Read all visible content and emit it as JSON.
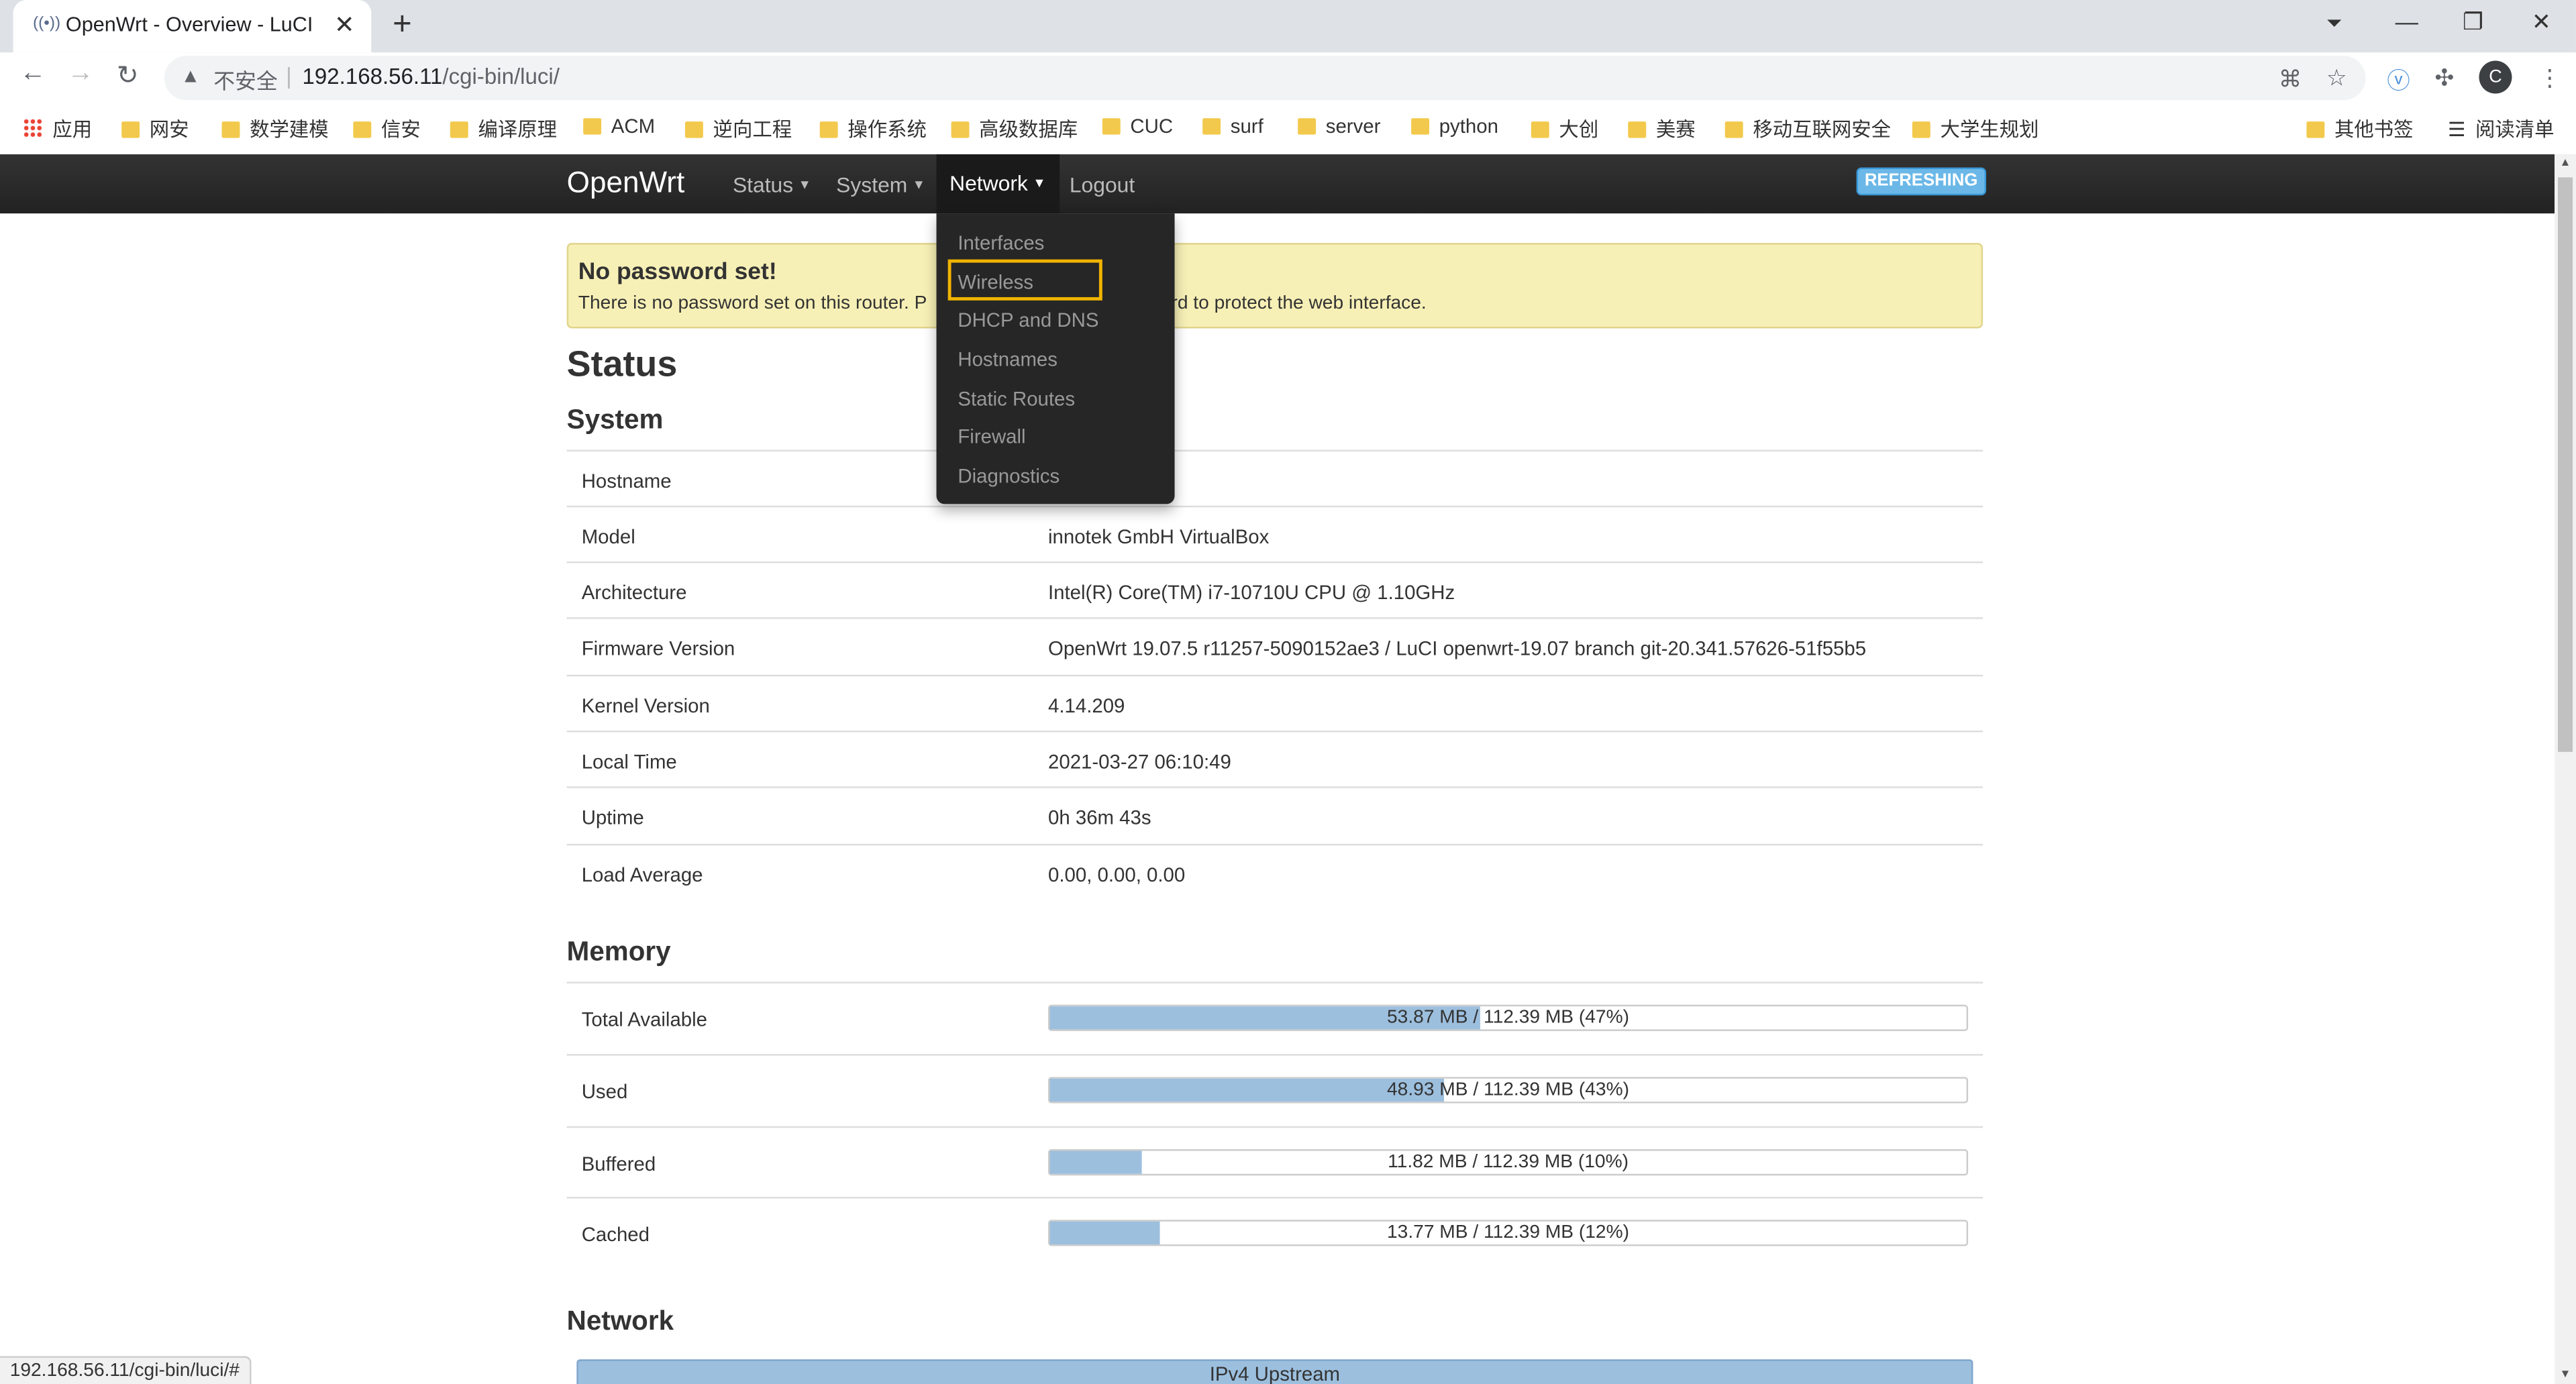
{
  "browser": {
    "tab_title": "OpenWrt - Overview - LuCI",
    "tab_close": "✕",
    "new_tab": "+",
    "insecure_label": "不安全",
    "url_host": "192.168.56.11",
    "url_path": "/cgi-bin/luci/",
    "avatar_letter": "C",
    "bookmarks": [
      "应用",
      "网安",
      "数学建模",
      "信安",
      "编译原理",
      "ACM",
      "逆向工程",
      "操作系统",
      "高级数据库",
      "CUC",
      "surf",
      "server",
      "python",
      "大创",
      "美赛",
      "移动互联网安全",
      "大学生规划"
    ],
    "other_bookmarks": "其他书签",
    "reading_list": "阅读清单",
    "status_url": "192.168.56.11/cgi-bin/luci/#"
  },
  "navbar": {
    "brand": "OpenWrt",
    "menus": [
      "Status",
      "System",
      "Network",
      "Logout"
    ],
    "active_menu": "Network",
    "refreshing": "REFRESHING"
  },
  "network_menu": {
    "items": [
      "Interfaces",
      "Wireless",
      "DHCP and DNS",
      "Hostnames",
      "Static Routes",
      "Firewall",
      "Diagnostics"
    ],
    "highlighted": "Wireless"
  },
  "alert": {
    "title": "No password set!",
    "text_left": "There is no password set on this router. P",
    "text_right": "word to protect the web interface."
  },
  "page_title": "Status",
  "system": {
    "heading": "System",
    "rows": [
      {
        "key": "Hostname",
        "value": ""
      },
      {
        "key": "Model",
        "value": "innotek GmbH VirtualBox"
      },
      {
        "key": "Architecture",
        "value": "Intel(R) Core(TM) i7-10710U CPU @ 1.10GHz"
      },
      {
        "key": "Firmware Version",
        "value": "OpenWrt 19.07.5 r11257-5090152ae3 / LuCI openwrt-19.07 branch git-20.341.57626-51f55b5"
      },
      {
        "key": "Kernel Version",
        "value": "4.14.209"
      },
      {
        "key": "Local Time",
        "value": "2021-03-27 06:10:49"
      },
      {
        "key": "Uptime",
        "value": "0h 36m 43s"
      },
      {
        "key": "Load Average",
        "value": "0.00, 0.00, 0.00"
      }
    ]
  },
  "memory": {
    "heading": "Memory",
    "rows": [
      {
        "key": "Total Available",
        "text": "53.87 MB / 112.39 MB (47%)",
        "percent": 47
      },
      {
        "key": "Used",
        "text": "48.93 MB / 112.39 MB (43%)",
        "percent": 43
      },
      {
        "key": "Buffered",
        "text": "11.82 MB / 112.39 MB (10%)",
        "percent": 10
      },
      {
        "key": "Cached",
        "text": "13.77 MB / 112.39 MB (12%)",
        "percent": 12
      }
    ]
  },
  "network": {
    "heading": "Network",
    "upstream_label": "IPv4 Upstream"
  },
  "colors": {
    "navbar": "#222222",
    "progress_fill": "#9cbfde",
    "alert_bg": "#f7f0b6",
    "highlight_border": "#f0b400"
  }
}
